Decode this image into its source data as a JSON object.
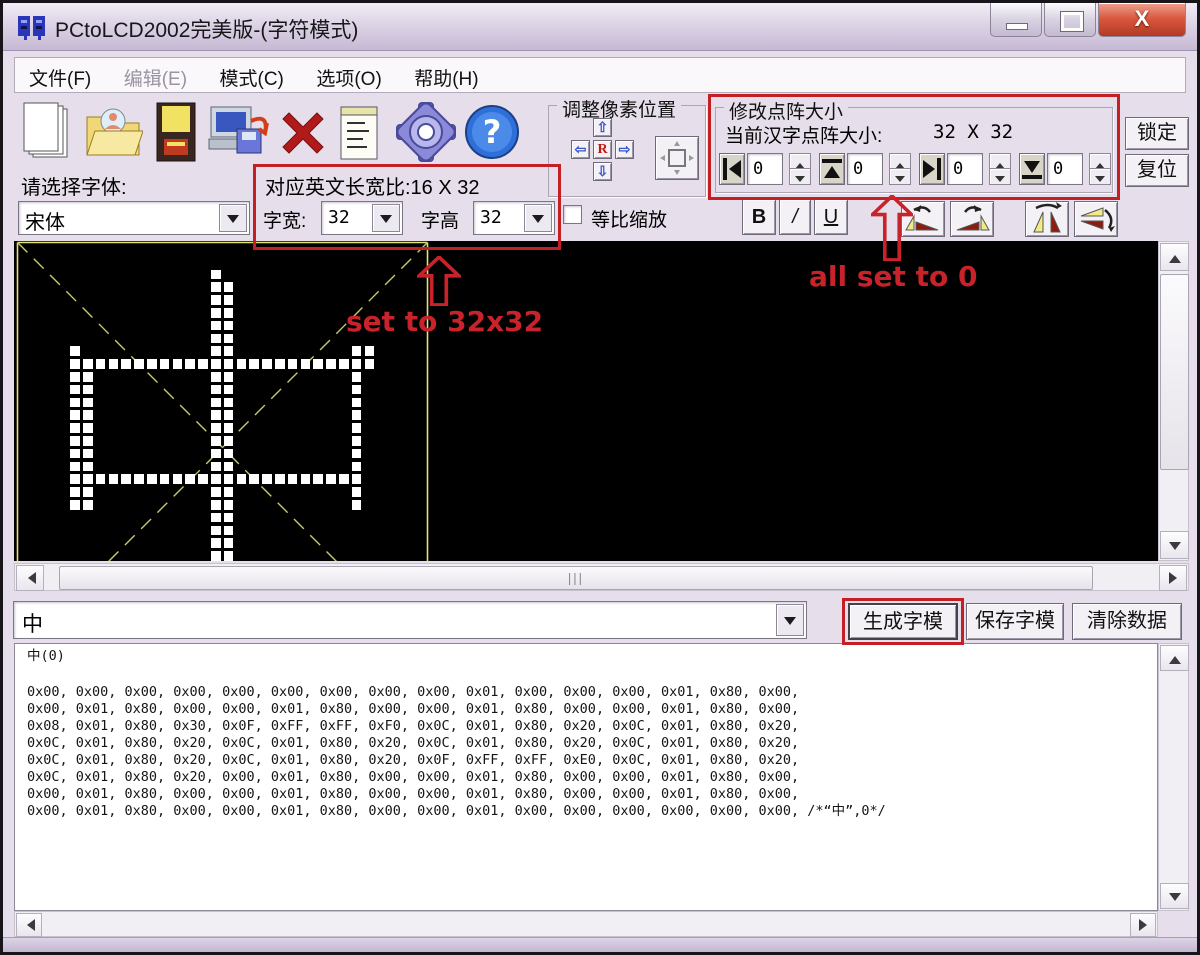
{
  "window": {
    "title": "PCtoLCD2002完美版-(字符模式)",
    "close_glyph": "X"
  },
  "menu_bar": {
    "items": [
      {
        "label": "文件(F)",
        "enabled": true
      },
      {
        "label": "编辑(E)",
        "enabled": false
      },
      {
        "label": "模式(C)",
        "enabled": true
      },
      {
        "label": "选项(O)",
        "enabled": true
      },
      {
        "label": "帮助(H)",
        "enabled": true
      }
    ]
  },
  "toolbar": {
    "icons": [
      "new-document",
      "open-file",
      "save-floppy",
      "save-as-computer",
      "delete-x",
      "notes-document",
      "settings-gear",
      "help"
    ]
  },
  "font_selector": {
    "label": "请选择字体:",
    "value": "宋体"
  },
  "char_size": {
    "ratio_label": "对应英文长宽比:16 X 32",
    "width_label": "字宽:",
    "width_value": "32",
    "height_label": "字高",
    "height_value": "32"
  },
  "scale_checkbox": {
    "label": "等比缩放",
    "checked": false
  },
  "pixel_position_panel": {
    "title": "调整像素位置",
    "up": "⇧",
    "left": "⇦",
    "center": "R",
    "right": "⇨",
    "down": "⇩"
  },
  "matrix_panel": {
    "title": "修改点阵大小",
    "current_label": "当前汉字点阵大小:",
    "current_value": "32 X 32",
    "spinners": [
      {
        "icon": "pad-left-icon",
        "value": "0"
      },
      {
        "icon": "pad-top-icon",
        "value": "0"
      },
      {
        "icon": "pad-right-icon",
        "value": "0"
      },
      {
        "icon": "pad-bottom-icon",
        "value": "0"
      }
    ]
  },
  "side_buttons": {
    "lock": "锁定",
    "reset": "复位"
  },
  "format_buttons": {
    "bold": "B",
    "italic": "/",
    "underline": "U"
  },
  "annotations": {
    "size_note": "set to 32x32",
    "zero_note": "all set to 0",
    "color": "#c41f25"
  },
  "char_input": {
    "value": "中"
  },
  "actions": {
    "generate": "生成字模",
    "save": "保存字模",
    "clear": "清除数据"
  },
  "output": {
    "header": "中(0)",
    "hex_lines": [
      "0x00, 0x00, 0x00, 0x00, 0x00, 0x00, 0x00, 0x00, 0x00, 0x01, 0x00, 0x00, 0x00, 0x01, 0x80, 0x00,",
      "0x00, 0x01, 0x80, 0x00, 0x00, 0x01, 0x80, 0x00, 0x00, 0x01, 0x80, 0x00, 0x00, 0x01, 0x80, 0x00,",
      "0x08, 0x01, 0x80, 0x30, 0x0F, 0xFF, 0xFF, 0xF0, 0x0C, 0x01, 0x80, 0x20, 0x0C, 0x01, 0x80, 0x20,",
      "0x0C, 0x01, 0x80, 0x20, 0x0C, 0x01, 0x80, 0x20, 0x0C, 0x01, 0x80, 0x20, 0x0C, 0x01, 0x80, 0x20,",
      "0x0C, 0x01, 0x80, 0x20, 0x0C, 0x01, 0x80, 0x20, 0x0F, 0xFF, 0xFF, 0xE0, 0x0C, 0x01, 0x80, 0x20,",
      "0x0C, 0x01, 0x80, 0x20, 0x00, 0x01, 0x80, 0x00, 0x00, 0x01, 0x80, 0x00, 0x00, 0x01, 0x80, 0x00,",
      "0x00, 0x01, 0x80, 0x00, 0x00, 0x01, 0x80, 0x00, 0x00, 0x01, 0x80, 0x00, 0x00, 0x01, 0x80, 0x00,",
      "0x00, 0x01, 0x80, 0x00, 0x00, 0x01, 0x80, 0x00, 0x00, 0x01, 0x00, 0x00, 0x00, 0x00, 0x00, 0x00, /*“中”,0*/"
    ]
  },
  "preview": {
    "grid_size": 32,
    "accent_yellow": "#d9d96c"
  }
}
